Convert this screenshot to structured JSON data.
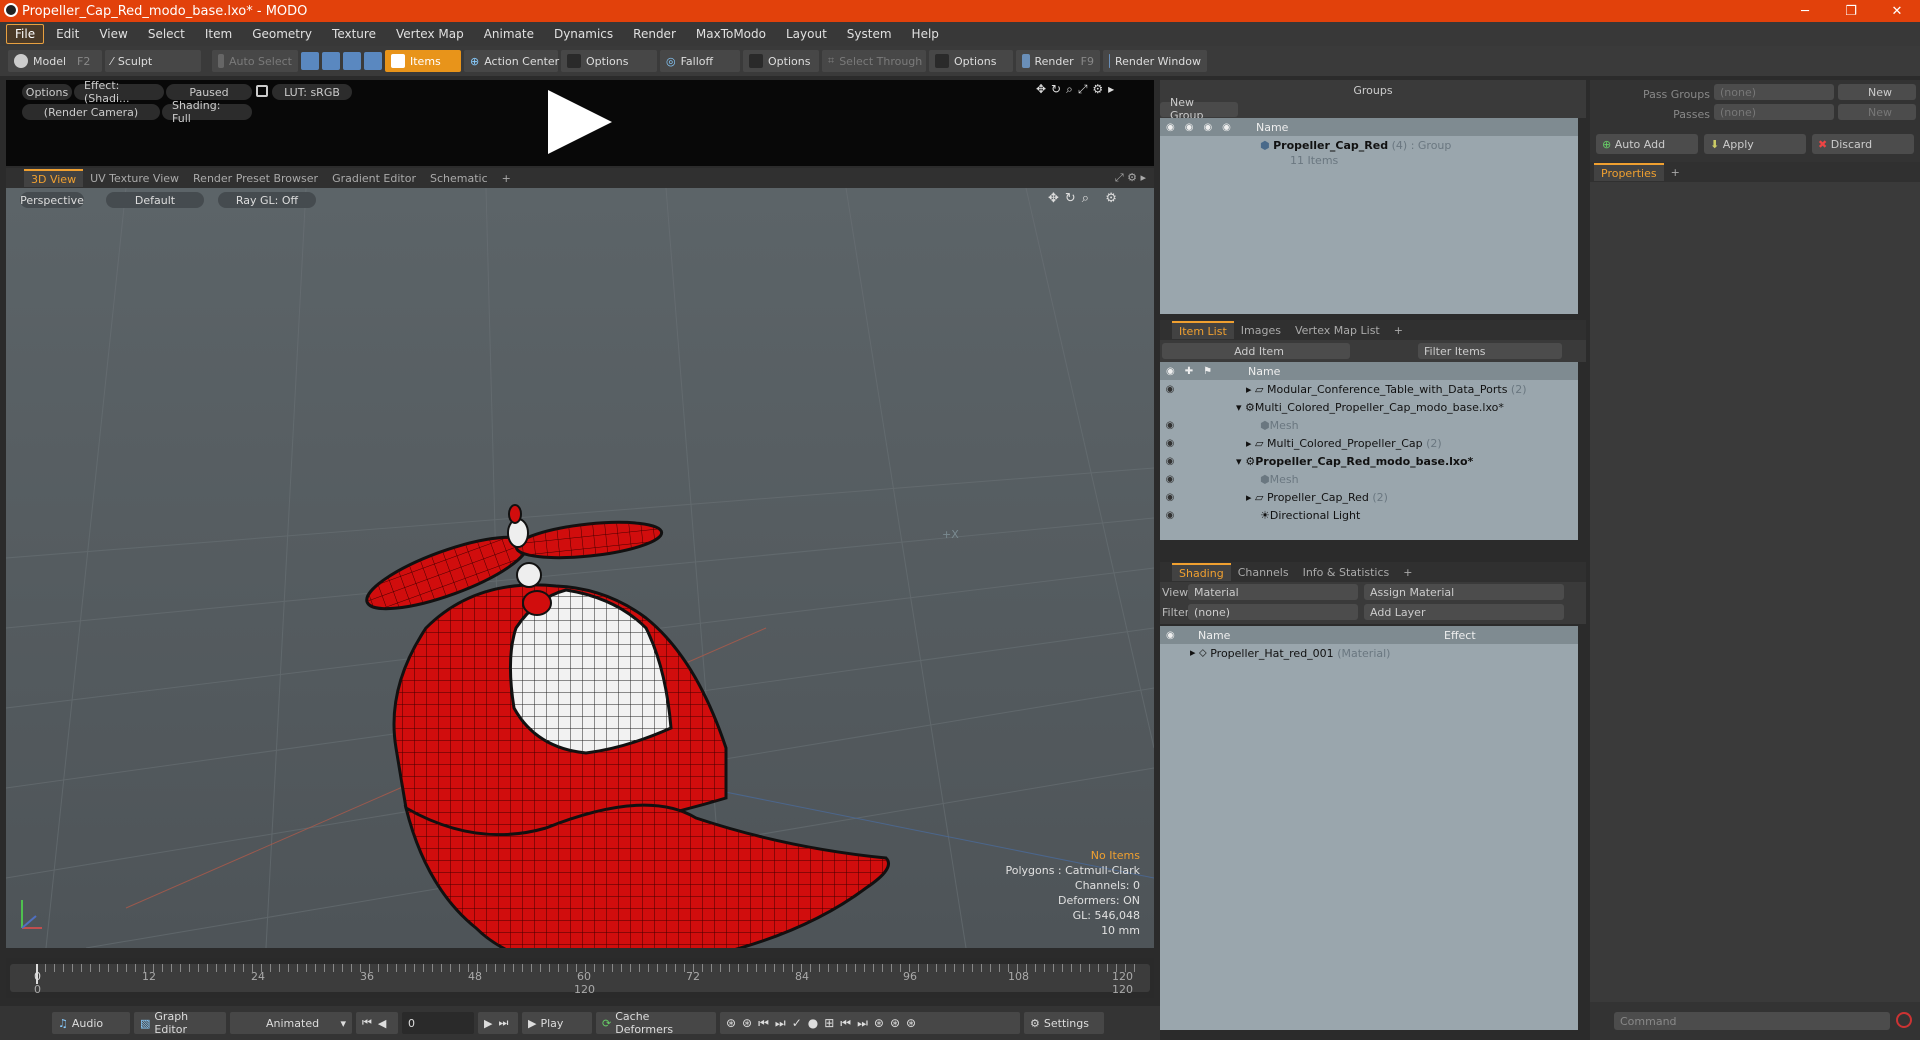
{
  "window": {
    "title": "Propeller_Cap_Red_modo_base.lxo* - MODO",
    "minimize": "─",
    "maximize": "❐",
    "close": "✕"
  },
  "menu": [
    "File",
    "Edit",
    "View",
    "Select",
    "Item",
    "Geometry",
    "Texture",
    "Vertex Map",
    "Animate",
    "Dynamics",
    "Render",
    "MaxToModo",
    "Layout",
    "System",
    "Help"
  ],
  "toolbar": {
    "model": "Model",
    "model_key": "F2",
    "sculpt": "Sculpt",
    "auto_select": "Auto Select",
    "items": "Items",
    "action_center": "Action Center",
    "options1": "Options",
    "falloff": "Falloff",
    "options2": "Options",
    "select_through": "Select Through",
    "options3": "Options",
    "render": "Render",
    "render_key": "F9",
    "render_window": "Render Window"
  },
  "preview": {
    "options": "Options",
    "effect": "Effect: (Shadi...",
    "paused": "Paused",
    "lut": "LUT: sRGB",
    "camera": "(Render Camera)",
    "shading": "Shading: Full"
  },
  "view_tabs": [
    "3D View",
    "UV Texture View",
    "Render Preset Browser",
    "Gradient Editor",
    "Schematic",
    "+"
  ],
  "viewport": {
    "perspective": "Perspective",
    "default": "Default",
    "raygl": "Ray GL: Off",
    "axis_label": "+X"
  },
  "stats": {
    "no_items": "No Items",
    "polygons": "Polygons : Catmull-Clark",
    "channels": "Channels: 0",
    "deformers": "Deformers: ON",
    "gl": "GL: 546,048",
    "scale": "10 mm"
  },
  "timeline": {
    "ticks": [
      "0",
      "12",
      "24",
      "36",
      "48",
      "60",
      "72",
      "84",
      "96",
      "108",
      "120"
    ],
    "start": "0",
    "end": "120",
    "mid": "120"
  },
  "bottom": {
    "audio": "Audio",
    "graph_editor": "Graph Editor",
    "animated": "Animated",
    "frame": "0",
    "play": "Play",
    "cache": "Cache Deformers",
    "settings": "Settings"
  },
  "groups": {
    "title": "Groups",
    "new_group": "New Group",
    "col_name": "Name",
    "row_name": "Propeller_Cap_Red",
    "row_count": "(4)",
    "row_type": ": Group",
    "row_items": "11 Items"
  },
  "itemlist": {
    "tabs": [
      "Item List",
      "Images",
      "Vertex Map List",
      "+"
    ],
    "add_item": "Add Item",
    "filter": "Filter Items",
    "col_name": "Name",
    "rows": [
      {
        "label": "Modular_Conference_Table_with_Data_Ports",
        "suffix": "(2)"
      },
      {
        "label": "Multi_Colored_Propeller_Cap_modo_base.lxo*",
        "suffix": ""
      },
      {
        "label": "Mesh",
        "suffix": ""
      },
      {
        "label": "Multi_Colored_Propeller_Cap",
        "suffix": "(2)"
      },
      {
        "label": "Propeller_Cap_Red_modo_base.lxo*",
        "suffix": ""
      },
      {
        "label": "Mesh",
        "suffix": ""
      },
      {
        "label": "Propeller_Cap_Red",
        "suffix": "(2)"
      },
      {
        "label": "Directional Light",
        "suffix": ""
      }
    ]
  },
  "shading": {
    "tabs": [
      "Shading",
      "Channels",
      "Info & Statistics",
      "+"
    ],
    "view_label": "View",
    "view_value": "Material",
    "assign": "Assign Material",
    "filter_label": "Filter",
    "filter_value": "(none)",
    "add_layer": "Add Layer",
    "col_name": "Name",
    "col_effect": "Effect",
    "row_name": "Propeller_Hat_red_001",
    "row_type": "(Material)"
  },
  "right": {
    "pass_groups": "Pass Groups",
    "pass_groups_val": "(none)",
    "new1": "New",
    "passes": "Passes",
    "passes_val": "(none)",
    "new2": "New",
    "auto_add": "Auto Add",
    "apply": "Apply",
    "discard": "Discard",
    "properties": "Properties",
    "command": "Command"
  }
}
